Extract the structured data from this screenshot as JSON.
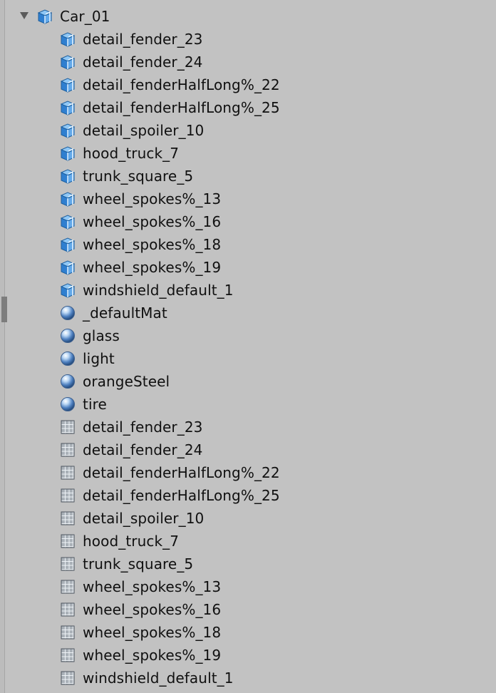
{
  "tree": {
    "root": {
      "label": "Car_01",
      "icon": "prefab-icon",
      "expanded": true
    },
    "children": [
      {
        "label": "detail_fender_23",
        "icon": "prefab-icon",
        "type": "prefab"
      },
      {
        "label": "detail_fender_24",
        "icon": "prefab-icon",
        "type": "prefab"
      },
      {
        "label": "detail_fenderHalfLong%_22",
        "icon": "prefab-icon",
        "type": "prefab"
      },
      {
        "label": "detail_fenderHalfLong%_25",
        "icon": "prefab-icon",
        "type": "prefab"
      },
      {
        "label": "detail_spoiler_10",
        "icon": "prefab-icon",
        "type": "prefab"
      },
      {
        "label": "hood_truck_7",
        "icon": "prefab-icon",
        "type": "prefab"
      },
      {
        "label": "trunk_square_5",
        "icon": "prefab-icon",
        "type": "prefab"
      },
      {
        "label": "wheel_spokes%_13",
        "icon": "prefab-icon",
        "type": "prefab"
      },
      {
        "label": "wheel_spokes%_16",
        "icon": "prefab-icon",
        "type": "prefab"
      },
      {
        "label": "wheel_spokes%_18",
        "icon": "prefab-icon",
        "type": "prefab"
      },
      {
        "label": "wheel_spokes%_19",
        "icon": "prefab-icon",
        "type": "prefab"
      },
      {
        "label": "windshield_default_1",
        "icon": "prefab-icon",
        "type": "prefab"
      },
      {
        "label": "_defaultMat",
        "icon": "material-sphere-icon",
        "type": "material"
      },
      {
        "label": "glass",
        "icon": "material-sphere-icon",
        "type": "material"
      },
      {
        "label": "light",
        "icon": "material-sphere-icon",
        "type": "material"
      },
      {
        "label": "orangeSteel",
        "icon": "material-sphere-icon",
        "type": "material"
      },
      {
        "label": "tire",
        "icon": "material-sphere-icon",
        "type": "material"
      },
      {
        "label": "detail_fender_23",
        "icon": "mesh-grid-icon",
        "type": "mesh"
      },
      {
        "label": "detail_fender_24",
        "icon": "mesh-grid-icon",
        "type": "mesh"
      },
      {
        "label": "detail_fenderHalfLong%_22",
        "icon": "mesh-grid-icon",
        "type": "mesh"
      },
      {
        "label": "detail_fenderHalfLong%_25",
        "icon": "mesh-grid-icon",
        "type": "mesh"
      },
      {
        "label": "detail_spoiler_10",
        "icon": "mesh-grid-icon",
        "type": "mesh"
      },
      {
        "label": "hood_truck_7",
        "icon": "mesh-grid-icon",
        "type": "mesh"
      },
      {
        "label": "trunk_square_5",
        "icon": "mesh-grid-icon",
        "type": "mesh"
      },
      {
        "label": "wheel_spokes%_13",
        "icon": "mesh-grid-icon",
        "type": "mesh"
      },
      {
        "label": "wheel_spokes%_16",
        "icon": "mesh-grid-icon",
        "type": "mesh"
      },
      {
        "label": "wheel_spokes%_18",
        "icon": "mesh-grid-icon",
        "type": "mesh"
      },
      {
        "label": "wheel_spokes%_19",
        "icon": "mesh-grid-icon",
        "type": "mesh"
      },
      {
        "label": "windshield_default_1",
        "icon": "mesh-grid-icon",
        "type": "mesh"
      }
    ]
  },
  "colors": {
    "panel_bg": "#c2c2c2",
    "text": "#101010",
    "prefab_blue": "#3f8ed8",
    "material_blue": "#4c78b6",
    "mesh_gray": "#8a8f96"
  }
}
